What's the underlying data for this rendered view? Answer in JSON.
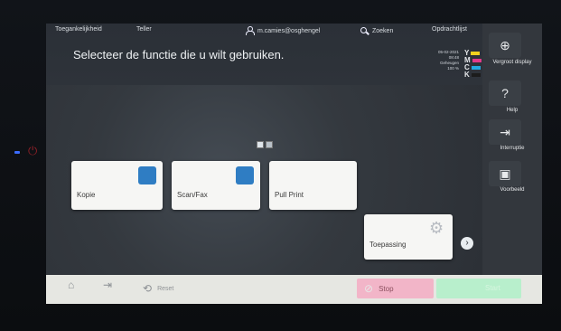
{
  "topbar": {
    "accessibility": "Toegankelijkheid",
    "counter": "Teller",
    "user": "m.camies@osghengel",
    "search": "Zoeken",
    "jobs": "Opdrachtlijst"
  },
  "title": "Selecteer de functie die u wilt gebruiken.",
  "status": {
    "date": "05-02-2021",
    "time": "08:48",
    "memory_label": "Geheugen",
    "memory_value": "100 %",
    "toner": [
      "Y",
      "M",
      "C",
      "K"
    ]
  },
  "tiles": {
    "copy": "Kopie",
    "scan": "Scan/Fax",
    "pull": "Pull Print",
    "app": "Toepassing"
  },
  "sidebar": {
    "zoom": "Vergroot display",
    "help": "Help",
    "interrupt": "Interruptie",
    "preview": "Voorbeeld"
  },
  "bottombar": {
    "reset": "Reset",
    "stop": "Stop",
    "start": "Start"
  },
  "colors": {
    "topbar": "#2b3037",
    "tile": "#f6f6f4",
    "icon_blue": "#2f7dc3",
    "bottombar": "#e6e7e2",
    "stop": "#f2b5c8",
    "start": "#b8efcc",
    "toner_y": "#f1d21e",
    "toner_m": "#e23a8a",
    "toner_c": "#24a9e1",
    "toner_k": "#1c1c1c"
  }
}
